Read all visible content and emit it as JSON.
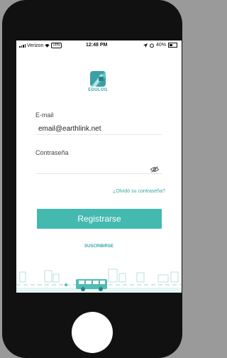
{
  "status_bar": {
    "carrier": "Verizon",
    "vpn": "VPN",
    "time": "12:48 PM",
    "battery": "40%"
  },
  "logo": {
    "text": "EDULOG"
  },
  "form": {
    "email_label": "E-mail",
    "email_value": "email@earthlink.net",
    "password_label": "Contraseña",
    "password_value": "",
    "forgot_link": "¿Olvidó su contraseña?",
    "submit_label": "Registrarse",
    "subscribe_link": "SUSCRIBIRSE"
  },
  "colors": {
    "accent": "#44b9b0",
    "link": "#3aa5a9"
  },
  "icons": [
    "wifi-icon",
    "location-icon",
    "alarm-icon",
    "battery-icon",
    "eye-icon",
    "logo-icon"
  ]
}
